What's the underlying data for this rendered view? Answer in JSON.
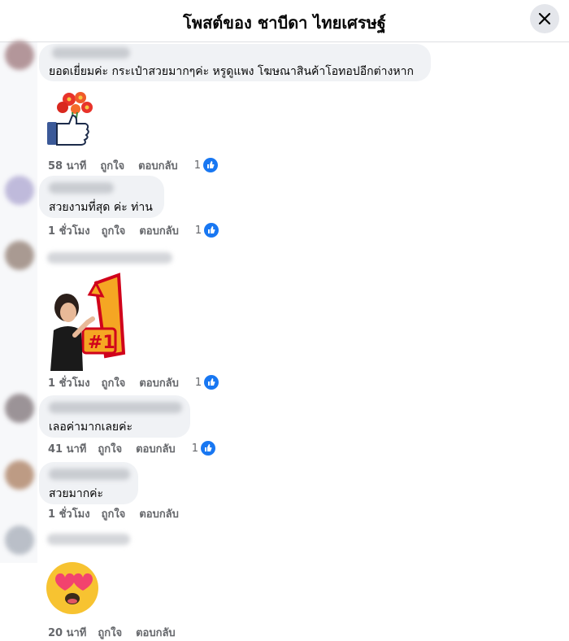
{
  "header": {
    "title": "โพสต์ของ ชาบีดา ไทยเศรษฐ์"
  },
  "comments": [
    {
      "text": "ยอดเยี่ยมค่ะ กระเป๋าสวยมากๆค่ะ หรูดูแพง โฆษณาสินค้าโอทอปอีกต่างหาก",
      "sticker": "flower-like-icon",
      "time": "58 นาที",
      "like_label": "ถูกใจ",
      "reply_label": "ตอบกลับ",
      "reactions": "1"
    },
    {
      "text": "สวยงามที่สุด ค่ะ ท่าน",
      "time": "1 ชั่วโมง",
      "like_label": "ถูกใจ",
      "reply_label": "ตอบกลับ",
      "reactions": "1"
    },
    {
      "sticker": "number-one-sticker",
      "sticker_text": "#1",
      "time": "1 ชั่วโมง",
      "like_label": "ถูกใจ",
      "reply_label": "ตอบกลับ",
      "reactions": "1"
    },
    {
      "text": "เลอค่ามากเลยค่ะ",
      "time": "41 นาที",
      "like_label": "ถูกใจ",
      "reply_label": "ตอบกลับ",
      "reactions": "1"
    },
    {
      "text": "สวยมากค่ะ",
      "time": "1 ชั่วโมง",
      "like_label": "ถูกใจ",
      "reply_label": "ตอบกลับ"
    },
    {
      "sticker": "heart-eyes-emoji",
      "time": "20 นาที",
      "like_label": "ถูกใจ",
      "reply_label": "ตอบกลับ"
    }
  ],
  "colors": {
    "accent": "#1877f2",
    "bubble": "#f0f2f5",
    "meta": "#65676b"
  }
}
